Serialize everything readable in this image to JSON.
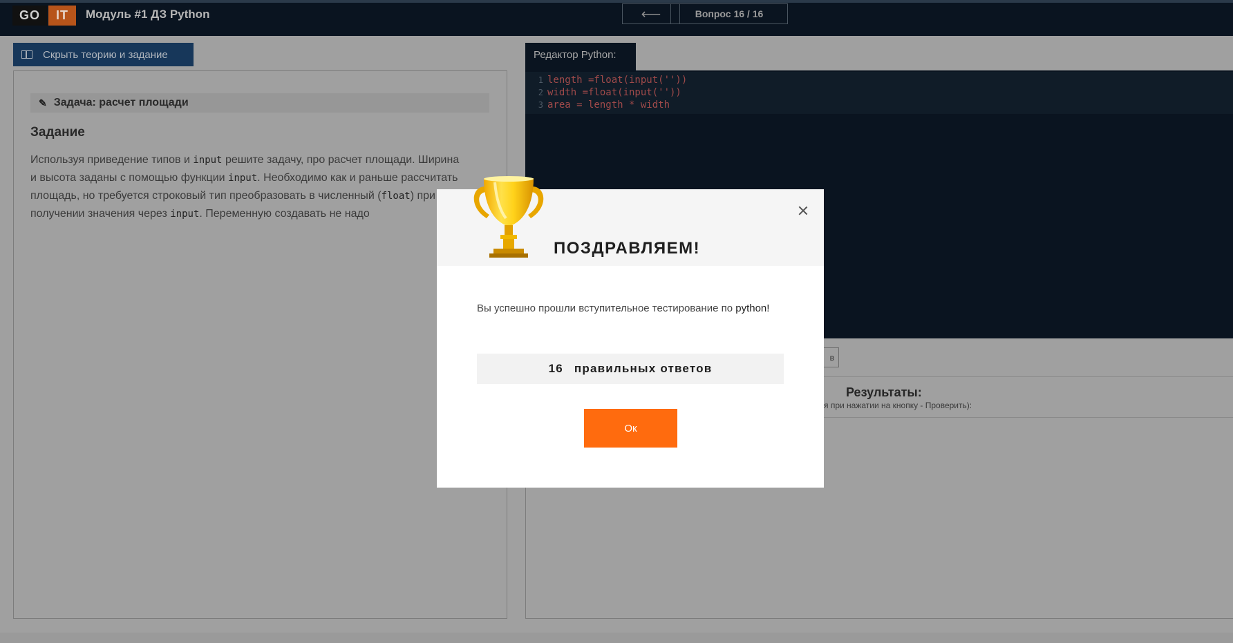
{
  "header": {
    "logo_go": "GO",
    "logo_it": "IT",
    "module_title": "Модуль #1 ДЗ Python",
    "back_arrow": "⟵",
    "question_counter": "Вопрос 16 / 16"
  },
  "left": {
    "hide_button_label": "Скрыть теорию и задание",
    "task_heading": "Задача: расчет площади",
    "section_title": "Задание",
    "task_text_parts": {
      "p1": "Используя приведение типов и ",
      "c1": "input",
      "p2": " решите задачу, про расчет площади. Ширина и высота заданы с помощью функции ",
      "c2": "input",
      "p3": ". Необходимо как и раньше рассчитать площадь, но требуется строковый тип преобразовать в численный (",
      "c3": "float",
      "p4": ") при получении значения через ",
      "c4": "input",
      "p5": ". Переменную создавать не надо"
    }
  },
  "editor": {
    "tab_label": "Редактор Python:",
    "lines": [
      {
        "n": "1",
        "code": "length =float(input(''))"
      },
      {
        "n": "2",
        "code": "width =float(input(''))"
      },
      {
        "n": "3",
        "code": "area = length * width"
      }
    ]
  },
  "results": {
    "small_button_tail": "в",
    "title": "Результаты:",
    "hint": "ся при нажатии на кнопку - Проверить):"
  },
  "modal": {
    "title": "ПОЗДРАВЛЯЕМ!",
    "message": "Вы успешно прошли вступительное тестирование по ",
    "message_bold": "python!",
    "score_number": "16",
    "score_label": "правильных ответов",
    "ok_label": "Ок",
    "icon": "trophy-icon",
    "ok_color": "#ff6b0e"
  }
}
